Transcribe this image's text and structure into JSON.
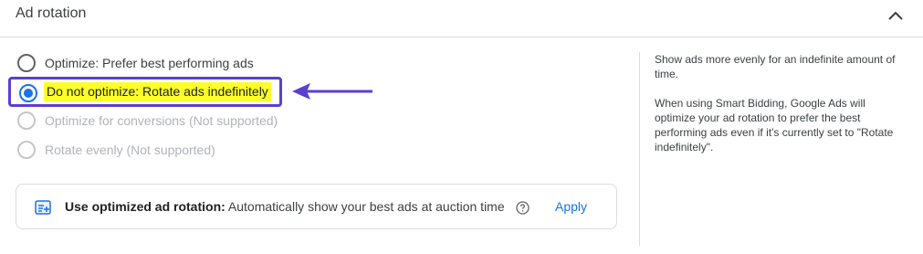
{
  "header": {
    "title": "Ad rotation",
    "collapse_icon": "chevron-up-icon"
  },
  "options": [
    {
      "label": "Optimize: Prefer best performing ads",
      "selected": false,
      "disabled": false
    },
    {
      "label": "Do not optimize: Rotate ads indefinitely",
      "selected": true,
      "disabled": false
    },
    {
      "label": "Optimize for conversions (Not supported)",
      "selected": false,
      "disabled": true
    },
    {
      "label": "Rotate evenly (Not supported)",
      "selected": false,
      "disabled": true
    }
  ],
  "annotation": {
    "highlight_color": "#fcff2a",
    "outline_color": "#5b3fd1",
    "arrow_icon": "arrow-left-icon"
  },
  "recommendation": {
    "icon": "optimize-icon",
    "title": "Use optimized ad rotation:",
    "text": "Automatically show your best ads at auction time",
    "help_icon": "help-circle-icon",
    "apply_label": "Apply"
  },
  "help_panel": {
    "paragraph1": "Show ads more evenly for an indefinite amount of time.",
    "paragraph2": "When using Smart Bidding, Google Ads will optimize your ad rotation to prefer the best performing ads even if it's currently set to \"Rotate indefinitely\"."
  },
  "colors": {
    "accent": "#1a73e8",
    "text": "#3c4043",
    "disabled_text": "#b0b3b8"
  }
}
